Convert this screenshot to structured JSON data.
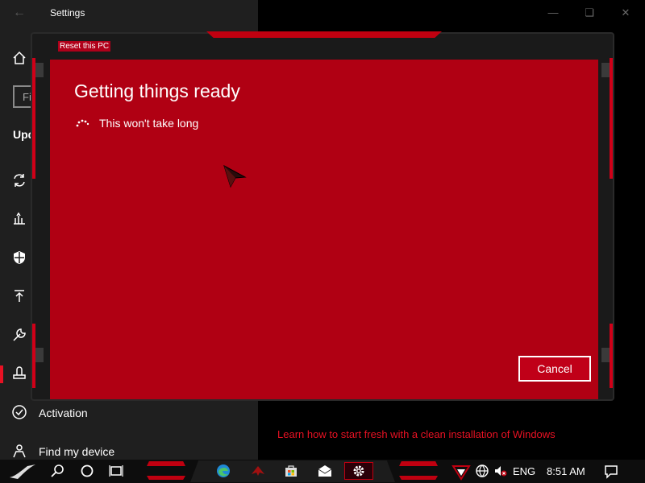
{
  "settings_window": {
    "title": "Settings",
    "search_text": "Fi",
    "section_heading": "Upd",
    "sidebar_items": [
      {
        "label": "",
        "icon": "sync-icon"
      },
      {
        "label": "",
        "icon": "delivery-optimization-icon"
      },
      {
        "label": "",
        "icon": "windows-security-icon"
      },
      {
        "label": "",
        "icon": "backup-icon"
      },
      {
        "label": "",
        "icon": "troubleshoot-icon"
      },
      {
        "label": "",
        "icon": "recovery-icon"
      },
      {
        "label": "Activation",
        "icon": "activation-icon"
      },
      {
        "label": "Find my device",
        "icon": "find-my-device-icon"
      }
    ],
    "learn_link": "Learn how to start fresh with a clean installation of Windows"
  },
  "modal": {
    "caption": "Reset this PC",
    "heading": "Getting things ready",
    "status": "This won't take long",
    "cancel_label": "Cancel"
  },
  "taskbar": {
    "language": "ENG",
    "time": "8:51 AM"
  },
  "colors": {
    "accent": "#e81123",
    "modal_bg": "#b00013",
    "sidebar_bg": "#1f1f1f"
  }
}
